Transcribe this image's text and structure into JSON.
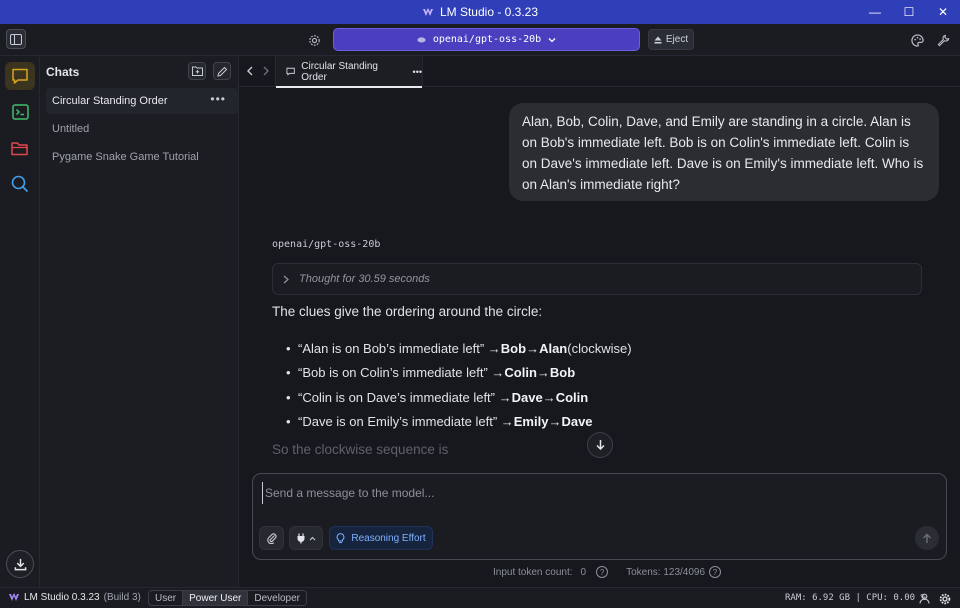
{
  "window": {
    "title": "LM Studio - 0.3.23",
    "controls": [
      "—",
      "☐",
      "✕"
    ]
  },
  "toolbar": {
    "model": "openai/gpt-oss-20b",
    "eject_label": "Eject"
  },
  "sidebar": {
    "title": "Chats",
    "chats": [
      {
        "label": "Circular Standing Order",
        "active": true
      },
      {
        "label": "Untitled",
        "active": false
      },
      {
        "label": "Pygame Snake Game Tutorial",
        "active": false
      }
    ],
    "more_glyph": "•••"
  },
  "tabs": {
    "active_label": "Circular Standing Order",
    "more_glyph": "•••"
  },
  "conversation": {
    "user_message": "Alan, Bob, Colin, Dave, and Emily are standing in a circle. Alan is on Bob's immediate left. Bob is on Colin's immediate left. Colin is on Dave's immediate left. Dave is on Emily's immediate left. Who is on Alan's immediate right?",
    "model_name": "openai/gpt-oss-20b",
    "thought_label": "Thought for 30.59 seconds",
    "answer_intro": "The clues give the ordering around the circle:",
    "bullets": [
      {
        "quote": "“Alan is on Bob’s immediate left” → ",
        "a": "Bob",
        "b": "Alan",
        "suffix": " (clockwise)"
      },
      {
        "quote": "“Bob is on Colin’s immediate left” → ",
        "a": "Colin",
        "b": "Bob",
        "suffix": ""
      },
      {
        "quote": "“Colin is on Dave’s immediate left” → ",
        "a": "Dave",
        "b": "Colin",
        "suffix": ""
      },
      {
        "quote": "“Dave is on Emily’s immediate left” → ",
        "a": "Emily",
        "b": "Dave",
        "suffix": ""
      }
    ],
    "arrow": " → ",
    "faded_line": "So the clockwise sequence is"
  },
  "composer": {
    "placeholder": "Send a message to the model...",
    "reasoning_label": "Reasoning Effort"
  },
  "tokens": {
    "input_label": "Input token count:",
    "input_value": "0",
    "tokens_label": "Tokens: 123/4096"
  },
  "statusbar": {
    "app": "LM Studio 0.3.23",
    "build": "(Build 3)",
    "modes": [
      {
        "label": "User",
        "active": false
      },
      {
        "label": "Power User",
        "active": true
      },
      {
        "label": "Developer",
        "active": false
      }
    ],
    "stats": "RAM: 6.92 GB  |  CPU: 0.00 %"
  },
  "colors": {
    "accent": "#4b3fbf",
    "titlebar": "#2e3fb7",
    "chat_active": "#d9a521"
  }
}
